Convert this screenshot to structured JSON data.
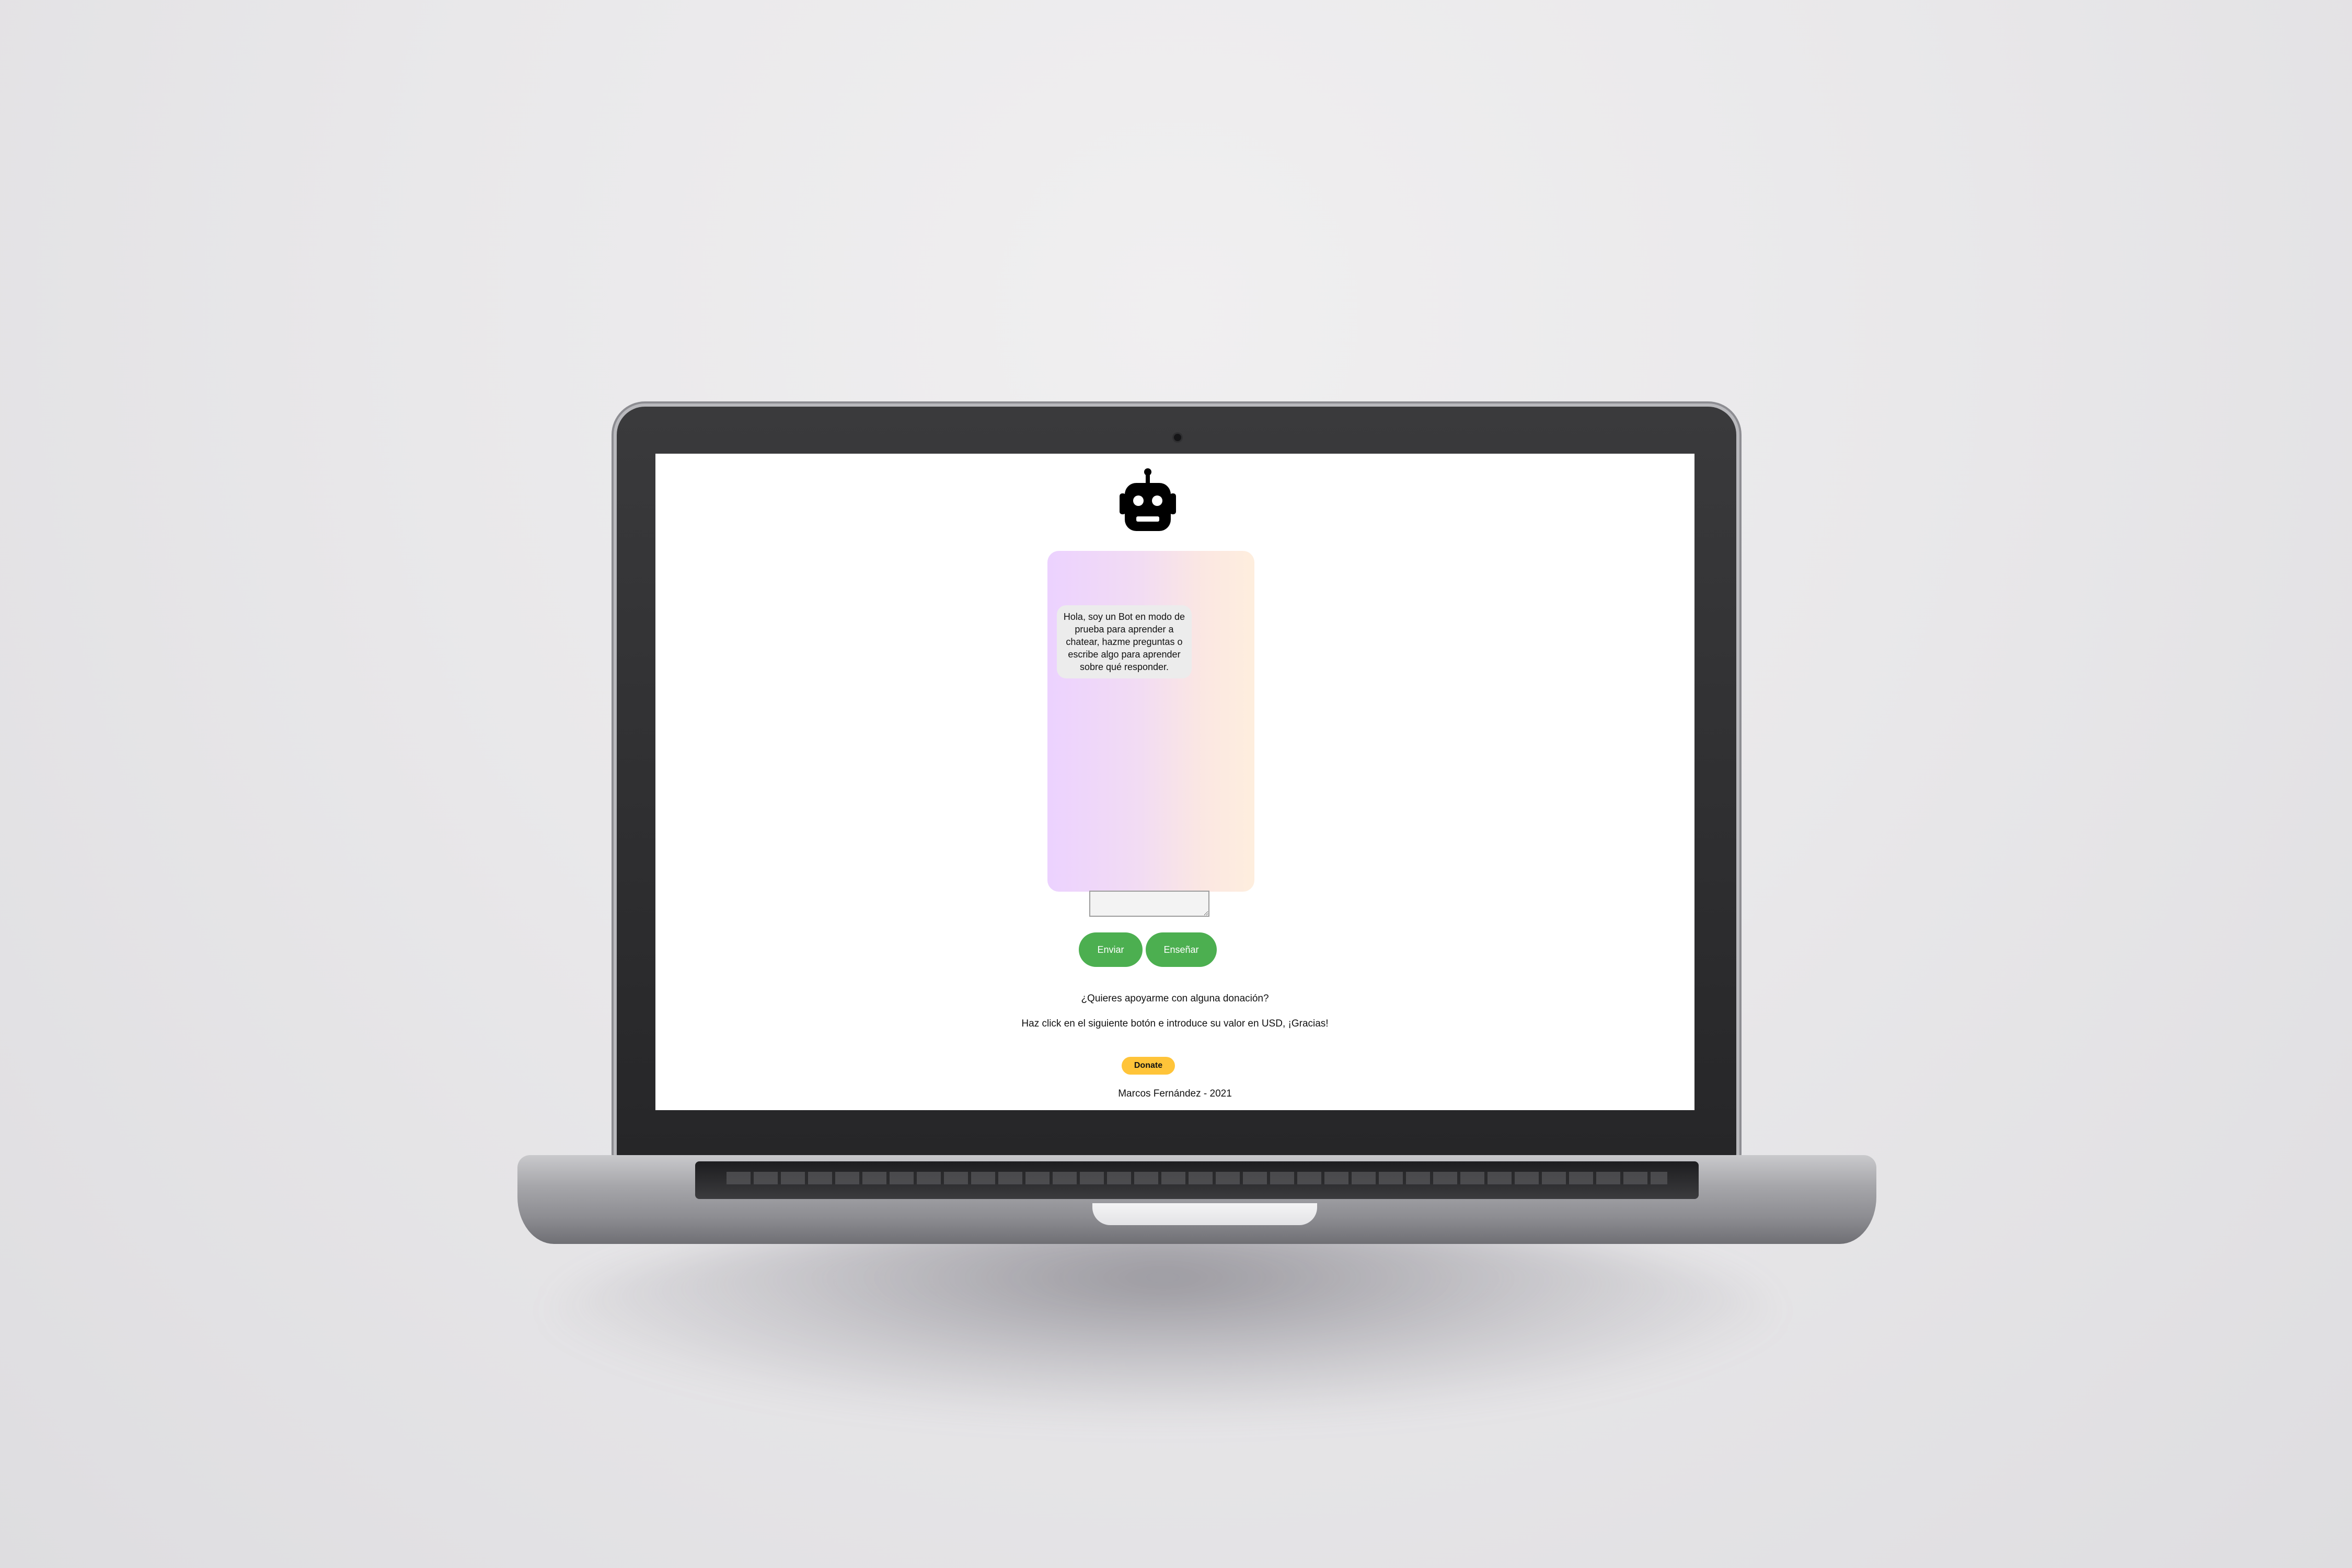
{
  "chat": {
    "bot_greeting": "Hola, soy un Bot en modo de prueba para aprender a chatear, hazme preguntas o escribe algo para aprender sobre qué responder.",
    "input_value": "",
    "input_placeholder": ""
  },
  "buttons": {
    "send_label": "Enviar",
    "teach_label": "Enseñar"
  },
  "donation": {
    "question": "¿Quieres apoyarme con alguna donación?",
    "instructions": "Haz click en el siguiente botón e introduce su valor en USD, ¡Gracias!",
    "button_label": "Donate"
  },
  "footer": {
    "text": "Marcos Fernández - 2021"
  },
  "colors": {
    "button_green": "#4caf50",
    "donate_yellow": "#ffc439",
    "chat_gradient_start": "#ecd2ff",
    "chat_gradient_end": "#feeede"
  },
  "icons": {
    "logo": "robot-icon"
  }
}
